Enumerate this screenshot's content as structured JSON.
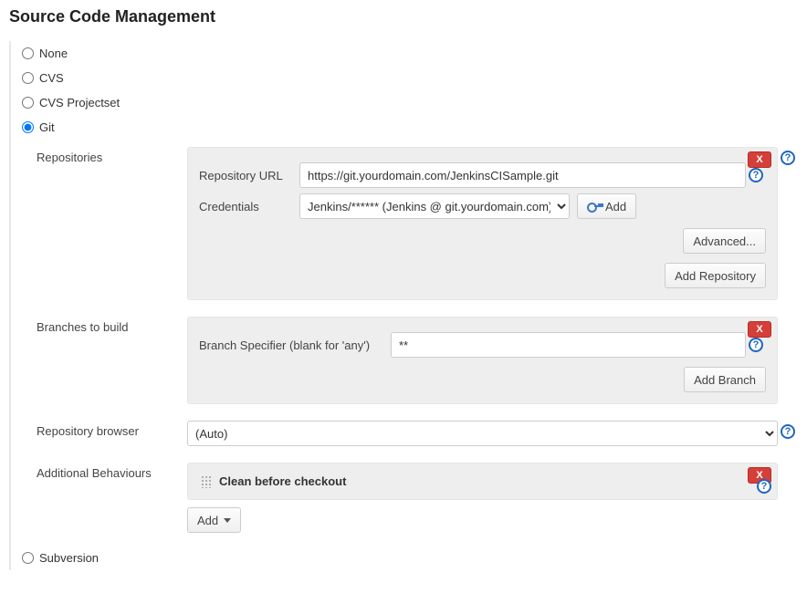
{
  "title": "Source Code Management",
  "scm_options": {
    "none": "None",
    "cvs": "CVS",
    "cvs_projectset": "CVS Projectset",
    "git": "Git",
    "subversion": "Subversion"
  },
  "git": {
    "repositories_label": "Repositories",
    "repo_url_label": "Repository URL",
    "repo_url_value": "https://git.yourdomain.com/JenkinsCISample.git",
    "credentials_label": "Credentials",
    "credentials_selected": "Jenkins/****** (Jenkins @ git.yourdomain.com)",
    "add_credential_label": "Add",
    "advanced_label": "Advanced...",
    "add_repository_label": "Add Repository",
    "branches_label": "Branches to build",
    "branch_specifier_label": "Branch Specifier (blank for 'any')",
    "branch_specifier_value": "**",
    "add_branch_label": "Add Branch",
    "repo_browser_label": "Repository browser",
    "repo_browser_selected": "(Auto)",
    "additional_behaviours_label": "Additional Behaviours",
    "behaviour_item": "Clean before checkout",
    "add_behaviour_label": "Add"
  }
}
